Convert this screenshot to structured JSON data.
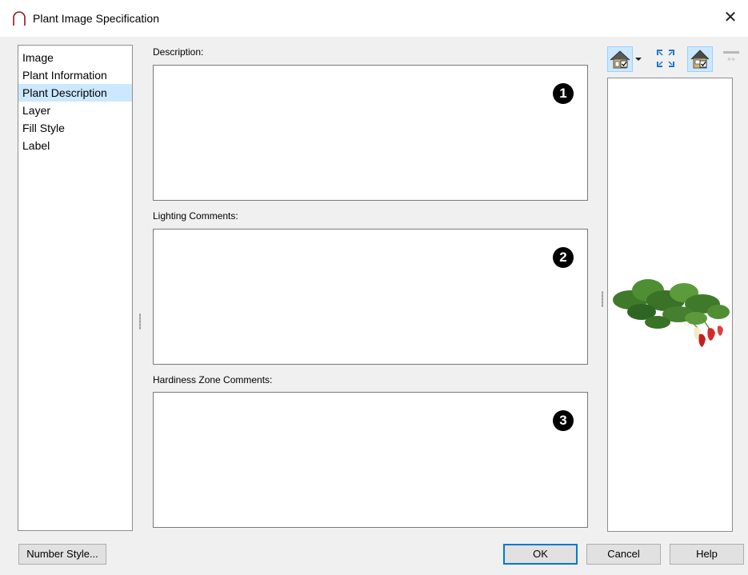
{
  "window": {
    "title": "Plant Image Specification",
    "close_glyph": "✕"
  },
  "nav": {
    "items": [
      {
        "label": "Image",
        "selected": false
      },
      {
        "label": "Plant Information",
        "selected": false
      },
      {
        "label": "Plant Description",
        "selected": true
      },
      {
        "label": "Layer",
        "selected": false
      },
      {
        "label": "Fill Style",
        "selected": false
      },
      {
        "label": "Label",
        "selected": false
      }
    ]
  },
  "fields": {
    "description": {
      "label": "Description:",
      "value": "",
      "badge": "1"
    },
    "lighting": {
      "label": "Lighting Comments:",
      "value": "",
      "badge": "2"
    },
    "hardiness": {
      "label": "Hardiness Zone Comments:",
      "value": "",
      "badge": "3"
    }
  },
  "toolbar": {
    "icons": [
      "house-view-icon",
      "dropdown-arrow-icon",
      "fit-view-icon",
      "show-house-icon",
      "divider-icon"
    ]
  },
  "preview": {
    "image": "strawberry-plant"
  },
  "buttons": {
    "number_style": "Number Style...",
    "ok": "OK",
    "cancel": "Cancel",
    "help": "Help"
  },
  "colors": {
    "selection": "#cce8ff",
    "default_button_border": "#0078d7"
  }
}
